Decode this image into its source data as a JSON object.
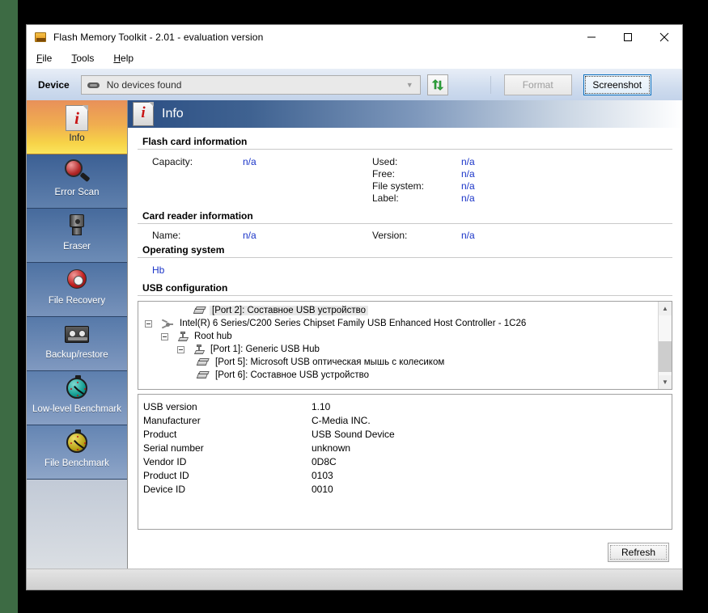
{
  "window": {
    "title": "Flash Memory Toolkit - 2.01 - evaluation version",
    "app_icon": "memory-card-icon",
    "controls": {
      "minimize": "minimize-icon",
      "maximize": "maximize-icon",
      "close": "close-icon"
    }
  },
  "menubar": {
    "items": [
      {
        "label": "File",
        "accel": "F",
        "rest": "ile"
      },
      {
        "label": "Tools",
        "accel": "T",
        "rest": "ools"
      },
      {
        "label": "Help",
        "accel": "H",
        "rest": "elp"
      }
    ]
  },
  "toolstrip": {
    "device_label": "Device",
    "device_combo_value": "No devices found",
    "device_combo_placeholder": "No devices found",
    "refresh_icon": "refresh-arrows-icon",
    "format_button": "Format",
    "format_enabled": false,
    "screenshot_button": "Screenshot",
    "screenshot_focused": true
  },
  "sidebar": {
    "items": [
      {
        "label": "Info",
        "icon": "info-document-icon",
        "selected": true
      },
      {
        "label": "Error Scan",
        "icon": "magnifier-icon",
        "selected": false
      },
      {
        "label": "Eraser",
        "icon": "eraser-icon",
        "selected": false
      },
      {
        "label": "File Recovery",
        "icon": "life-ring-icon",
        "selected": false
      },
      {
        "label": "Backup/restore",
        "icon": "cassette-tape-icon",
        "selected": false
      },
      {
        "label": "Low-level Benchmark",
        "icon": "stopwatch-teal-icon",
        "selected": false
      },
      {
        "label": "File Benchmark",
        "icon": "stopwatch-yellow-icon",
        "selected": false
      }
    ]
  },
  "panel": {
    "header_title": "Info",
    "header_icon": "info-document-icon",
    "sections": {
      "flash_card": {
        "title": "Flash card information",
        "left": [
          {
            "key": "Capacity:",
            "value": "n/a"
          }
        ],
        "right": [
          {
            "key": "Used:",
            "value": "n/a"
          },
          {
            "key": "Free:",
            "value": "n/a"
          },
          {
            "key": "File system:",
            "value": "n/a"
          },
          {
            "key": "Label:",
            "value": "n/a"
          }
        ]
      },
      "card_reader": {
        "title": "Card reader information",
        "name_key": "Name:",
        "name_value": "n/a",
        "version_key": "Version:",
        "version_value": "n/a"
      },
      "operating_system": {
        "title": "Operating system",
        "value": "Hb"
      },
      "usb_configuration": {
        "title": "USB configuration"
      }
    },
    "usb_tree": [
      {
        "indent": 4,
        "expander": "none",
        "icon": "usb-device-icon",
        "label": "[Port 2]: Составное USB устройство",
        "selected": true
      },
      {
        "indent": 0,
        "expander": "minus",
        "icon": "usb-controller-icon",
        "label": "Intel(R) 6 Series/C200 Series Chipset Family USB Enhanced Host Controller - 1C26",
        "selected": false
      },
      {
        "indent": 1,
        "expander": "minus",
        "icon": "usb-hub-icon",
        "label": "Root hub",
        "selected": false
      },
      {
        "indent": 2,
        "expander": "minus",
        "icon": "usb-hub-icon",
        "label": "[Port 1]: Generic USB Hub",
        "selected": false
      },
      {
        "indent": 3,
        "expander": "none",
        "icon": "usb-device-icon",
        "label": "[Port 5]: Microsoft USB оптическая мышь с колесиком",
        "selected": false
      },
      {
        "indent": 3,
        "expander": "none",
        "icon": "usb-device-icon",
        "label": "[Port 6]: Составное USB устройство",
        "selected": false
      }
    ],
    "usb_details": [
      {
        "key": "USB version",
        "value": "1.10"
      },
      {
        "key": "Manufacturer",
        "value": "C-Media INC."
      },
      {
        "key": "Product",
        "value": "USB Sound Device"
      },
      {
        "key": "Serial number",
        "value": "unknown"
      },
      {
        "key": "Vendor ID",
        "value": "0D8C"
      },
      {
        "key": "Product ID",
        "value": "0103"
      },
      {
        "key": "Device ID",
        "value": "0010"
      }
    ],
    "refresh_button": "Refresh"
  },
  "colors": {
    "accent_blue": "#2c4f84",
    "value_blue": "#1a34c8",
    "selected_tab_orange": "#f0ad50",
    "sidebar_blue": "#32517e"
  }
}
